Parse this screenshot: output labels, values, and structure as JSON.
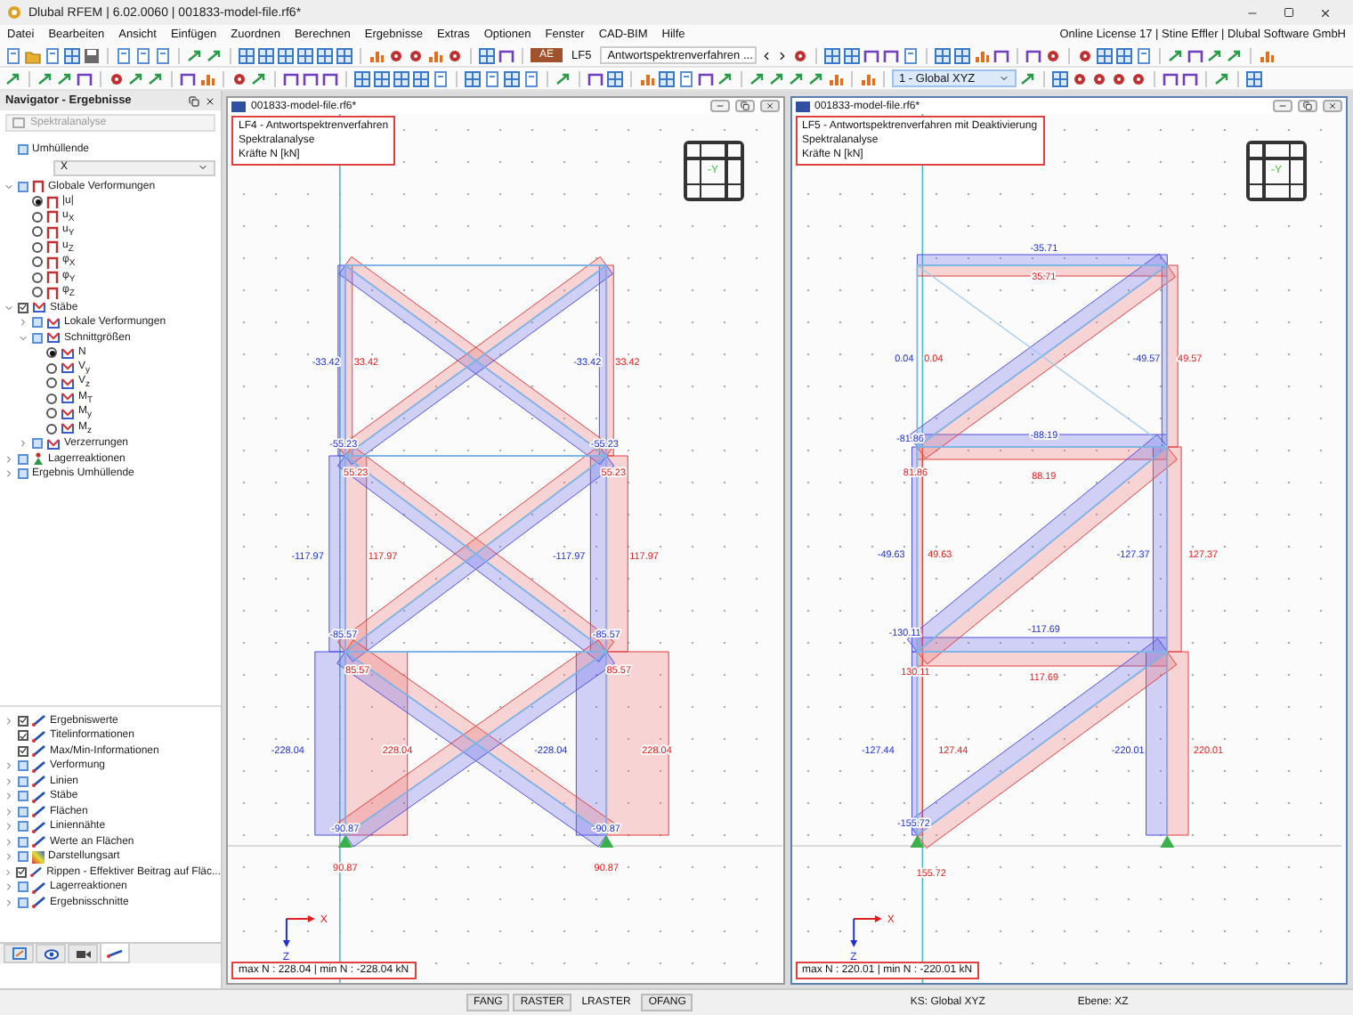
{
  "window": {
    "title": "Dlubal RFEM | 6.02.0060 | 001833-model-file.rf6*"
  },
  "menu": [
    "Datei",
    "Bearbeiten",
    "Ansicht",
    "Einfügen",
    "Zuordnen",
    "Berechnen",
    "Ergebnisse",
    "Extras",
    "Optionen",
    "Fenster",
    "CAD-BIM",
    "Hilfe"
  ],
  "license": "Online License 17 | Stine Effler | Dlubal Software GmbH",
  "toolbar": {
    "badge": "AE",
    "load_case": "LF5",
    "load_case_name": "Antwortspektrenverfahren ...",
    "coordinate_system": "1 - Global XYZ"
  },
  "navigator": {
    "title": "Navigator - Ergebnisse",
    "analysis": "Spektralanalyse",
    "envelope": {
      "label": "Umhüllende",
      "checked": false
    },
    "envelope_value": "X",
    "tree": [
      {
        "label": "Globale Verformungen",
        "kind": "checkbox",
        "checked": false,
        "expanded": true,
        "children": [
          {
            "label": "|u|",
            "kind": "radio",
            "selected": true
          },
          {
            "label": "u$_{X}$",
            "kind": "radio",
            "selected": false
          },
          {
            "label": "u$_{Y}$",
            "kind": "radio",
            "selected": false
          },
          {
            "label": "u$_{Z}$",
            "kind": "radio",
            "selected": false
          },
          {
            "label": "φ$_{X}$",
            "kind": "radio",
            "selected": false
          },
          {
            "label": "φ$_{Y}$",
            "kind": "radio",
            "selected": false
          },
          {
            "label": "φ$_{Z}$",
            "kind": "radio",
            "selected": false
          }
        ]
      },
      {
        "label": "Stäbe",
        "kind": "checkbox",
        "checked": true,
        "expanded": true,
        "children": [
          {
            "label": "Lokale Verformungen",
            "kind": "checkbox",
            "checked": false,
            "expanded": false
          },
          {
            "label": "Schnittgrößen",
            "kind": "checkbox",
            "checked": false,
            "expanded": true,
            "children": [
              {
                "label": "N",
                "kind": "radio",
                "selected": true
              },
              {
                "label": "V$_{y}$",
                "kind": "radio",
                "selected": false
              },
              {
                "label": "V$_{z}$",
                "kind": "radio",
                "selected": false
              },
              {
                "label": "M$_{T}$",
                "kind": "radio",
                "selected": false
              },
              {
                "label": "M$_{y}$",
                "kind": "radio",
                "selected": false
              },
              {
                "label": "M$_{z}$",
                "kind": "radio",
                "selected": false
              }
            ]
          },
          {
            "label": "Verzerrungen",
            "kind": "checkbox",
            "checked": false,
            "expanded": false
          }
        ]
      },
      {
        "label": "Lagerreaktionen",
        "kind": "checkbox",
        "checked": false,
        "expanded": false
      },
      {
        "label": "Ergebnis Umhüllende",
        "kind": "checkbox",
        "checked": false,
        "expanded": false
      }
    ]
  },
  "display_items": [
    {
      "label": "Ergebniswerte",
      "checked": true,
      "expanded": false
    },
    {
      "label": "Titelinformationen",
      "checked": true
    },
    {
      "label": "Max/Min-Informationen",
      "checked": true
    },
    {
      "label": "Verformung",
      "checked": false,
      "expanded": false
    },
    {
      "label": "Linien",
      "checked": false,
      "expanded": false
    },
    {
      "label": "Stäbe",
      "checked": false,
      "expanded": false
    },
    {
      "label": "Flächen",
      "checked": false,
      "expanded": false
    },
    {
      "label": "Liniennähte",
      "checked": false,
      "expanded": false
    },
    {
      "label": "Werte an Flächen",
      "checked": false,
      "expanded": false
    },
    {
      "label": "Darstellungsart",
      "checked": false,
      "expanded": false
    },
    {
      "label": "Rippen - Effektiver Beitrag auf Fläc...",
      "checked": true,
      "expanded": false
    },
    {
      "label": "Lagerreaktionen",
      "checked": false,
      "expanded": false
    },
    {
      "label": "Ergebnisschnitte",
      "checked": false,
      "expanded": false
    }
  ],
  "navigator_tabs": [
    {
      "selected": false
    },
    {
      "selected": false
    },
    {
      "selected": false
    },
    {
      "selected": true
    }
  ],
  "views": [
    {
      "title": "001833-model-file.rf6*",
      "info": [
        "LF4 - Antwortspektrenverfahren",
        "Spektralanalyse",
        "Kräfte N [kN]"
      ],
      "cube_label": "-Y",
      "axis_x": "X",
      "axis_z": "Z",
      "summary": "max N : 228.04 | min N : -228.04 kN",
      "labels": [
        {
          "text": "-33.42",
          "kind": "negative"
        },
        {
          "text": "33.42",
          "kind": "positive"
        },
        {
          "text": "-33.42",
          "kind": "negative"
        },
        {
          "text": "33.42",
          "kind": "positive"
        },
        {
          "text": "-55.23",
          "kind": "negative"
        },
        {
          "text": "55.23",
          "kind": "positive"
        },
        {
          "text": "-55.23",
          "kind": "negative"
        },
        {
          "text": "55.23",
          "kind": "positive"
        },
        {
          "text": "-117.97",
          "kind": "negative"
        },
        {
          "text": "117.97",
          "kind": "positive"
        },
        {
          "text": "-117.97",
          "kind": "negative"
        },
        {
          "text": "117.97",
          "kind": "positive"
        },
        {
          "text": "-85.57",
          "kind": "negative"
        },
        {
          "text": "85.57",
          "kind": "positive"
        },
        {
          "text": "-85.57",
          "kind": "negative"
        },
        {
          "text": "85.57",
          "kind": "positive"
        },
        {
          "text": "-228.04",
          "kind": "negative"
        },
        {
          "text": "228.04",
          "kind": "positive"
        },
        {
          "text": "-228.04",
          "kind": "negative"
        },
        {
          "text": "228.04",
          "kind": "positive"
        },
        {
          "text": "-90.87",
          "kind": "negative"
        },
        {
          "text": "90.87",
          "kind": "positive"
        },
        {
          "text": "-90.87",
          "kind": "negative"
        },
        {
          "text": "90.87",
          "kind": "positive"
        }
      ]
    },
    {
      "title": "001833-model-file.rf6*",
      "info": [
        "LF5 - Antwortspektrenverfahren mit Deaktivierung",
        "Spektralanalyse",
        "Kräfte N [kN]"
      ],
      "cube_label": "-Y",
      "axis_x": "X",
      "axis_z": "Z",
      "summary": "max N : 220.01 | min N : -220.01 kN",
      "labels": [
        {
          "text": "-35.71",
          "kind": "negative"
        },
        {
          "text": "35.71",
          "kind": "positive"
        },
        {
          "text": "0.04",
          "kind": "negative"
        },
        {
          "text": "0.04",
          "kind": "positive"
        },
        {
          "text": "-49.57",
          "kind": "negative"
        },
        {
          "text": "49.57",
          "kind": "positive"
        },
        {
          "text": "-81.86",
          "kind": "negative"
        },
        {
          "text": "81.86",
          "kind": "positive"
        },
        {
          "text": "-88.19",
          "kind": "negative"
        },
        {
          "text": "88.19",
          "kind": "positive"
        },
        {
          "text": "-49.63",
          "kind": "negative"
        },
        {
          "text": "49.63",
          "kind": "positive"
        },
        {
          "text": "-127.37",
          "kind": "negative"
        },
        {
          "text": "127.37",
          "kind": "positive"
        },
        {
          "text": "-130.11",
          "kind": "negative"
        },
        {
          "text": "130.11",
          "kind": "positive"
        },
        {
          "text": "-117.69",
          "kind": "negative"
        },
        {
          "text": "117.69",
          "kind": "positive"
        },
        {
          "text": "-127.44",
          "kind": "negative"
        },
        {
          "text": "127.44",
          "kind": "positive"
        },
        {
          "text": "-220.01",
          "kind": "negative"
        },
        {
          "text": "220.01",
          "kind": "positive"
        },
        {
          "text": "-155.72",
          "kind": "negative"
        },
        {
          "text": "155.72",
          "kind": "positive"
        }
      ]
    }
  ],
  "status_toggles": [
    {
      "label": "FANG",
      "on": true
    },
    {
      "label": "RASTER",
      "on": true
    },
    {
      "label": "LRASTER",
      "on": false
    },
    {
      "label": "OFANG",
      "on": true
    }
  ],
  "status": {
    "coordinate_system": "KS: Global XYZ",
    "plane": "Ebene: XZ"
  }
}
